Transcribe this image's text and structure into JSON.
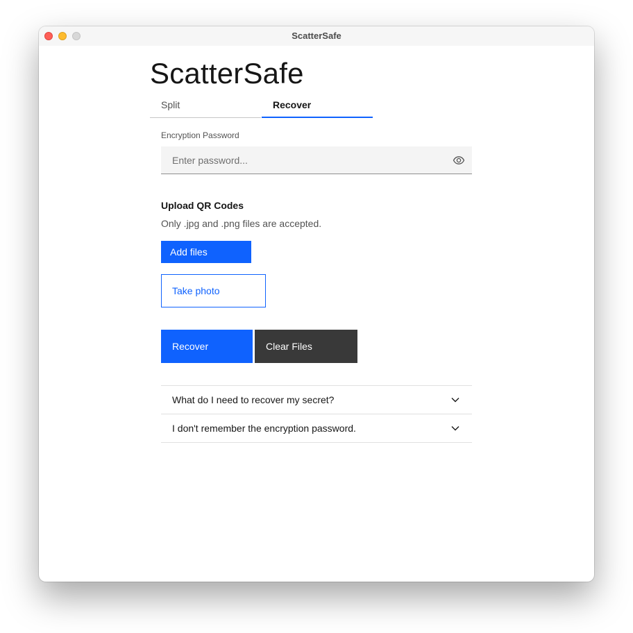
{
  "window": {
    "title": "ScatterSafe"
  },
  "app": {
    "title": "ScatterSafe"
  },
  "tabs": [
    {
      "label": "Split",
      "selected": false
    },
    {
      "label": "Recover",
      "selected": true
    }
  ],
  "password": {
    "label": "Encryption Password",
    "placeholder": "Enter password...",
    "value": "",
    "toggle_icon": "eye-icon"
  },
  "upload": {
    "heading": "Upload QR Codes",
    "hint": "Only .jpg and .png files are accepted.",
    "add_files_label": "Add files",
    "take_photo_label": "Take photo"
  },
  "actions": {
    "recover_label": "Recover",
    "clear_label": "Clear Files"
  },
  "faq": [
    {
      "question": "What do I need to recover my secret?",
      "icon": "chevron-down-icon"
    },
    {
      "question": "I don't remember the encryption password.",
      "icon": "chevron-down-icon"
    }
  ],
  "colors": {
    "primary": "#0f62fe",
    "secondary": "#393939",
    "text": "#161616",
    "field_bg": "#f4f4f4"
  }
}
